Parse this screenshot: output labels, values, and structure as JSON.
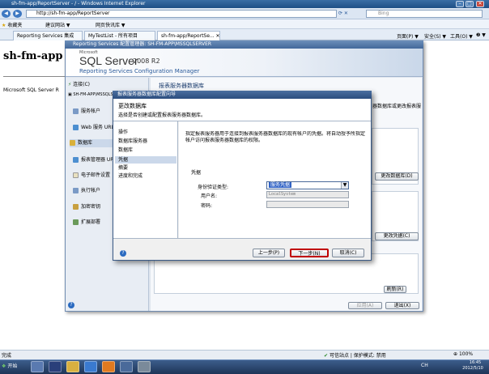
{
  "ie": {
    "title": "sh-fm-app/ReportServer - / - Windows Internet Explorer",
    "address": "http://sh-fm-app/ReportServer",
    "search_placeholder": "Bing",
    "favorites_label": "收藏夹",
    "fav_links": [
      "建议网站 ▼",
      "网页快讯库 ▼"
    ],
    "tabs": [
      "Reporting Services 集成",
      "MyTestList - 所有项目",
      "sh-fm-app/ReportSe... ✕"
    ],
    "cmd": [
      "页面(P) ▼",
      "安全(S) ▼",
      "工具(O) ▼",
      "❷ ▼"
    ]
  },
  "page": {
    "heading": "sh-fm-app",
    "footer_text": "Microsoft SQL Server R"
  },
  "rs": {
    "window_title": "Reporting Services 配置管理器: SH-FM-APP\\MSSQLSERVER",
    "brand_small": "Microsoft",
    "brand_main": "SQL Server",
    "brand_version": "2008 R2",
    "brand_sub": "Reporting Services Configuration Manager",
    "connect_label": "连接(C)",
    "instance": "SH-FM-APP\\MSSQLSE",
    "nav": [
      "服务帐户",
      "Web 服务 URL",
      "数据库",
      "报表管理器 URL",
      "电子邮件设置",
      "执行帐户",
      "加密密钥",
      "扩展部署"
    ],
    "section_title": "报表服务器数据库",
    "right_text": "器数据库或更改报表服务",
    "change_db_btn": "更改数据库(D)",
    "change_cred_btn": "更改凭据(C)",
    "apply_btn": "应用(A)",
    "exit_btn": "退出(X)",
    "refresh_btn": "刷新(R)"
  },
  "dlg": {
    "title": "报表服务器数据库配置向导",
    "head_title": "更改数据库",
    "head_sub": "选择是否创建或配置报表服务器数据库。",
    "steps": [
      "操作",
      "数据库服务器",
      "数据库",
      "凭据",
      "摘要",
      "进度和完成"
    ],
    "desc": "指定报表服务器用于连接到报表服务器数据库的现有帐户的凭据。将自动授予所指定帐户访问报表服务器数据库的权限。",
    "cred_label": "凭据",
    "auth_label": "身份验证类型:",
    "auth_value": "服务凭据",
    "user_label": "用户名:",
    "user_value": "LocalSystem",
    "pwd_label": "密码:",
    "pwd_value": "",
    "prev_btn": "上一步(P)",
    "next_btn": "下一步(N)",
    "cancel_btn": "取消(C)"
  },
  "status": {
    "text": "完成",
    "zone": "可信站点 | 保护模式: 禁用",
    "zoom": "100%"
  },
  "taskbar": {
    "start": "开始",
    "lang": "CH",
    "time": "16:45",
    "date": "2012/5/10"
  },
  "colors": {
    "accent": "#2b4d7e",
    "selected_step": "#cbd8ea",
    "next_border": "#c00000"
  }
}
